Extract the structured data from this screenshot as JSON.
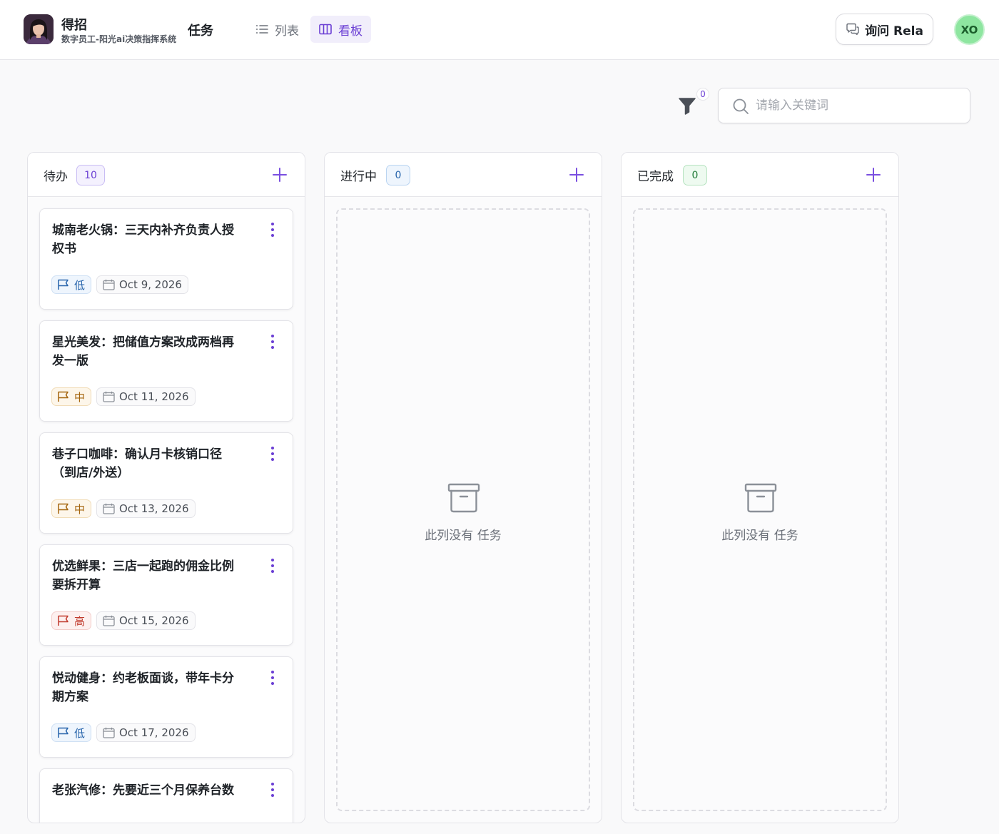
{
  "header": {
    "brand_name": "得招",
    "brand_sub": "数字员工-阳光ai决策指挥系统",
    "page_title": "任务",
    "tabs": {
      "list": "列表",
      "board": "看板"
    },
    "ask_button": "询问 Rela",
    "user_initials": "XO"
  },
  "toolbar": {
    "filter_count": "0",
    "search_placeholder": "请输入关键词"
  },
  "columns": {
    "todo": {
      "title": "待办",
      "count": "10"
    },
    "doing": {
      "title": "进行中",
      "count": "0",
      "empty_text": "此列没有 任务"
    },
    "done": {
      "title": "已完成",
      "count": "0",
      "empty_text": "此列没有 任务"
    }
  },
  "tasks": [
    {
      "title": "城南老火锅：三天内补齐负责人授权书",
      "priority": "低",
      "priority_level": "low",
      "date": "Oct 9, 2026"
    },
    {
      "title": "星光美发：把储值方案改成两档再发一版",
      "priority": "中",
      "priority_level": "mid",
      "date": "Oct 11, 2026"
    },
    {
      "title": "巷子口咖啡：确认月卡核销口径（到店/外送）",
      "priority": "中",
      "priority_level": "mid",
      "date": "Oct 13, 2026"
    },
    {
      "title": "优选鲜果：三店一起跑的佣金比例要拆开算",
      "priority": "高",
      "priority_level": "high",
      "date": "Oct 15, 2026"
    },
    {
      "title": "悦动健身：约老板面谈，带年卡分期方案",
      "priority": "低",
      "priority_level": "low",
      "date": "Oct 17, 2026"
    },
    {
      "title": "老张汽修：先要近三个月保养台数",
      "priority": "",
      "priority_level": "",
      "date": ""
    }
  ],
  "colors": {
    "accent": "#6b3fd4",
    "low": "#2563ab",
    "mid": "#a4640d",
    "high": "#c0392b"
  }
}
